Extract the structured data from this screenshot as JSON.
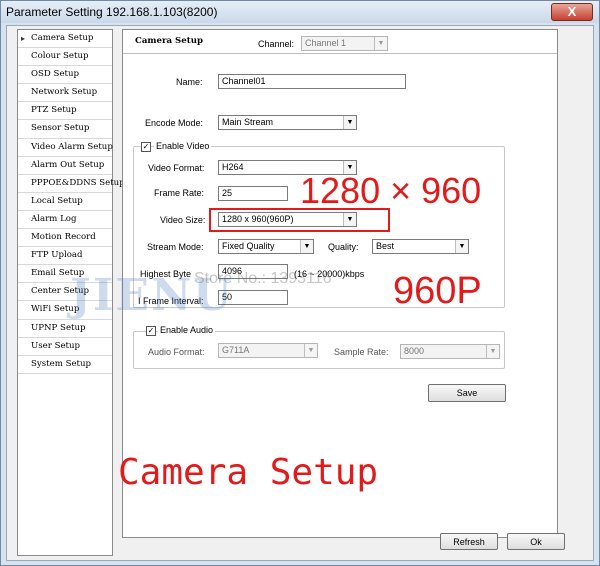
{
  "window": {
    "title": "Parameter Setting 192.168.1.103(8200)",
    "close_label": "X"
  },
  "sidebar": {
    "items": [
      {
        "label": "Camera Setup"
      },
      {
        "label": "Colour Setup"
      },
      {
        "label": "OSD Setup"
      },
      {
        "label": "Network Setup"
      },
      {
        "label": "PTZ Setup"
      },
      {
        "label": "Sensor Setup"
      },
      {
        "label": "Video Alarm Setup"
      },
      {
        "label": "Alarm Out Setup"
      },
      {
        "label": "PPPOE&DDNS Setup"
      },
      {
        "label": "Local Setup"
      },
      {
        "label": "Alarm Log"
      },
      {
        "label": "Motion Record"
      },
      {
        "label": "FTP Upload"
      },
      {
        "label": "Email Setup"
      },
      {
        "label": "Center Setup"
      },
      {
        "label": "WiFi Setup"
      },
      {
        "label": "UPNP Setup"
      },
      {
        "label": "User Setup"
      },
      {
        "label": "System Setup"
      }
    ]
  },
  "panel": {
    "title": "Camera Setup",
    "channel_label": "Channel:",
    "channel_value": "Channel 1",
    "name_label": "Name:",
    "name_value": "Channel01",
    "encode_mode_label": "Encode Mode:",
    "encode_mode_value": "Main Stream",
    "enable_video_label": "Enable Video",
    "video_format_label": "Video Format:",
    "video_format_value": "H264",
    "frame_rate_label": "Frame Rate:",
    "frame_rate_value": "25",
    "video_size_label": "Video Size:",
    "video_size_value": "1280 x 960(960P)",
    "stream_mode_label": "Stream Mode:",
    "stream_mode_value": "Fixed Quality",
    "quality_label": "Quality:",
    "quality_value": "Best",
    "highest_byte_label": "Highest Byte",
    "highest_byte_value": "4096",
    "highest_byte_range": "(16 ~ 20000)kbps",
    "iframe_interval_label": "I Frame Interval:",
    "iframe_interval_value": "50",
    "enable_audio_label": "Enable Audio",
    "audio_format_label": "Audio Format:",
    "audio_format_value": "G711A",
    "sample_rate_label": "Sample Rate:",
    "sample_rate_value": "8000",
    "save_label": "Save",
    "check_mark": "✓",
    "dropdown_arrow": "▼"
  },
  "footer": {
    "refresh_label": "Refresh",
    "ok_label": "Ok"
  },
  "overlay": {
    "resolution_text": "1280 × 960",
    "p_text": "960P",
    "caption": "Camera Setup",
    "store_watermark": "Store No.: 1393116",
    "brand_watermark": "JIENU",
    "accent_color": "#e31a1a"
  }
}
